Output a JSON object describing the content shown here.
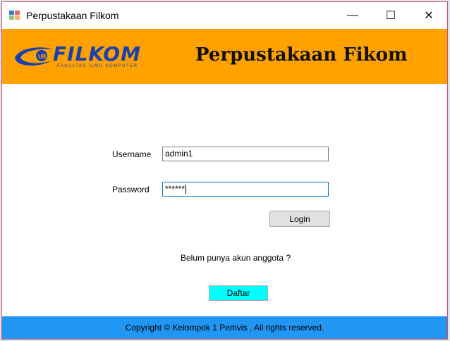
{
  "window": {
    "title": "Perpustakaan Filkom",
    "minimize_glyph": "—",
    "maximize_glyph": "☐",
    "close_glyph": "✕"
  },
  "banner": {
    "logo_text": "FILKOM",
    "logo_sub": "FAKULTAS ILMU KOMPUTER",
    "logo_badge": "UB",
    "title": "Perpustakaan Fikom",
    "background_color": "#ffa200"
  },
  "form": {
    "username_label": "Username",
    "username_value": "admin1",
    "password_label": "Password",
    "password_value": "******",
    "login_label": "Login",
    "register_prompt": "Belum punya akun anggota ?",
    "register_label": "Daftar"
  },
  "footer": {
    "text": "Copyright © Kelompok 1 Pemvis , All rights reserved.",
    "background_color": "#2196f3"
  }
}
